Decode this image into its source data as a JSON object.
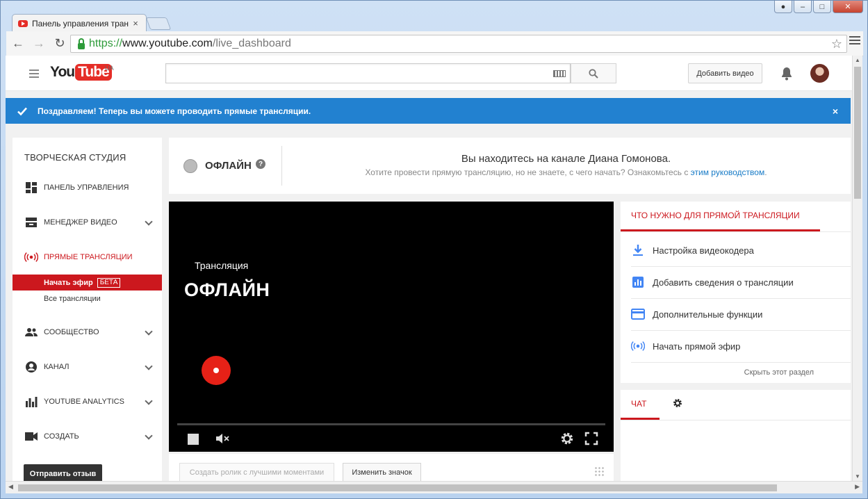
{
  "browser": {
    "tab_title": "Панель управления тран",
    "tab_close": "×",
    "url_https": "https://",
    "url_host": "www.youtube.com",
    "url_path": "/live_dashboard"
  },
  "header": {
    "logo_you": "You",
    "logo_tube": "Tube",
    "region": "UA",
    "search_placeholder": "",
    "upload_label": "Добавить видео"
  },
  "alert": {
    "message": "Поздравляем! Теперь вы можете проводить прямые трансляции.",
    "close": "×",
    "color": "#2281d0"
  },
  "sidebar": {
    "title": "ТВОРЧЕСКАЯ СТУДИЯ",
    "items": [
      {
        "label": "ПАНЕЛЬ УПРАВЛЕНИЯ",
        "icon": "dashboard-icon"
      },
      {
        "label": "МЕНЕДЖЕР ВИДЕО",
        "icon": "video-manager-icon"
      },
      {
        "label": "ПРЯМЫЕ ТРАНСЛЯЦИИ",
        "icon": "live-icon"
      },
      {
        "label": "СООБЩЕСТВО",
        "icon": "community-icon"
      },
      {
        "label": "КАНАЛ",
        "icon": "channel-icon"
      },
      {
        "label": "YOUTUBE ANALYTICS",
        "icon": "analytics-icon"
      },
      {
        "label": "СОЗДАТЬ",
        "icon": "create-icon"
      }
    ],
    "sub_active": "Начать эфир",
    "sub_badge": "БЕТА",
    "sub_item": "Все трансляции",
    "feedback": "Отправить отзыв",
    "accent": "#cc181e"
  },
  "status": {
    "state": "ОФЛАЙН",
    "help": "?",
    "channel_line": "Вы находитесь на канале Диана Гомонова.",
    "hint_prefix": "Хотите провести прямую трансляцию, но не знаете, с чего начать? Ознакомьтесь с ",
    "hint_link": "этим руководством",
    "hint_suffix": "."
  },
  "player": {
    "subtitle": "Трансляция",
    "state": "ОФЛАЙН",
    "highlights_button": "Создать ролик с лучшими моментами",
    "thumbnail_button": "Изменить значок"
  },
  "requirements": {
    "tab": "ЧТО НУЖНО ДЛЯ ПРЯМОЙ ТРАНСЛЯЦИИ",
    "items": [
      {
        "label": "Настройка видеокодера",
        "icon": "download-icon"
      },
      {
        "label": "Добавить сведения о трансляции",
        "icon": "chart-icon"
      },
      {
        "label": "Дополнительные функции",
        "icon": "card-icon"
      },
      {
        "label": "Начать прямой эфир",
        "icon": "live-icon"
      }
    ],
    "hide": "Скрыть этот раздел"
  },
  "chat": {
    "tab": "ЧАТ"
  }
}
